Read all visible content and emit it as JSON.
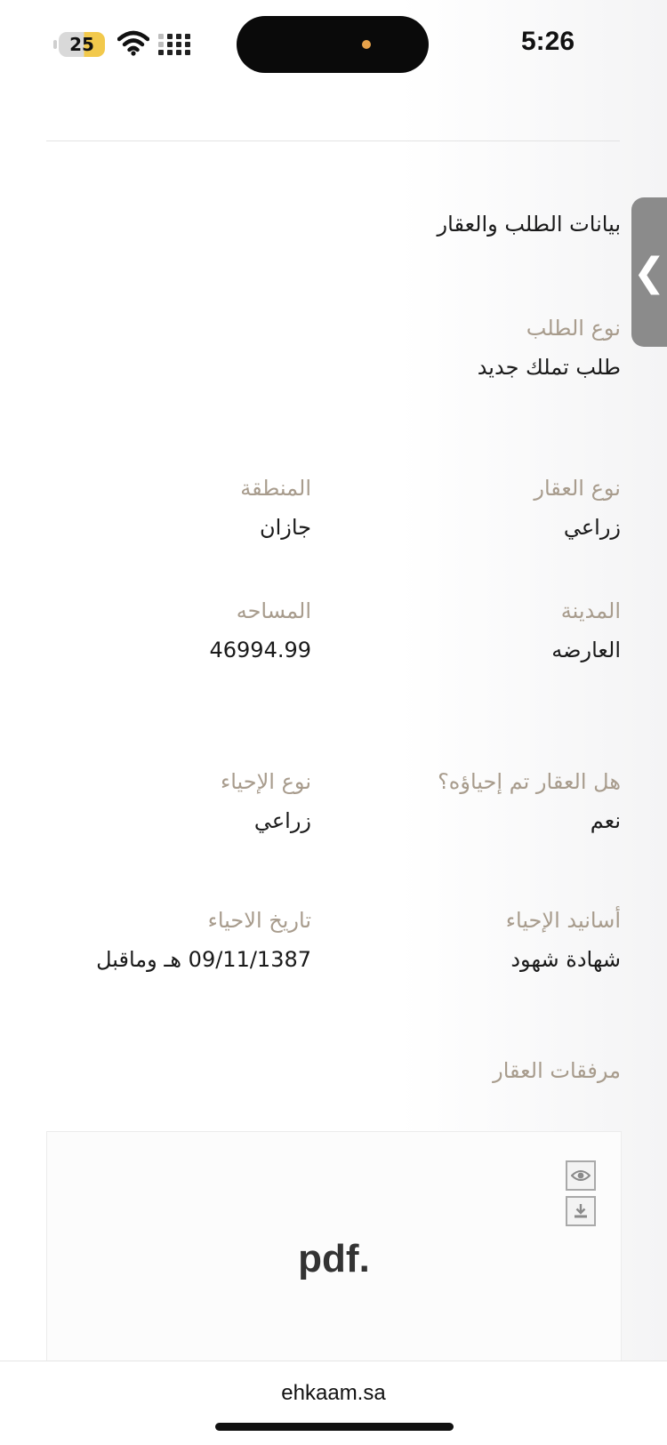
{
  "status_bar": {
    "battery_level": "25",
    "time": "5:26"
  },
  "side_tab": {
    "icon": "chevron-left-icon",
    "glyph": "❮"
  },
  "section": {
    "title": "بيانات الطلب والعقار"
  },
  "request": {
    "type_label": "نوع الطلب",
    "type_value": "طلب تملك جديد"
  },
  "property": {
    "type_label": "نوع العقار",
    "type_value": "زراعي",
    "region_label": "المنطقة",
    "region_value": "جازان",
    "city_label": "المدينة",
    "city_value": "العارضه",
    "area_label": "المساحه",
    "area_value": "46994.99",
    "revived_label": "هل العقار تم إحياؤه؟",
    "revived_value": "نعم",
    "revival_type_label": "نوع الإحياء",
    "revival_type_value": "زراعي",
    "revival_proof_label": "أسانيد الإحياء",
    "revival_proof_value": "شهادة شهود",
    "revival_date_label": "تاريخ الاحياء",
    "revival_date_value": "09/11/1387 هـ وماقبل"
  },
  "attachments": {
    "title": "مرفقات العقار",
    "file_ext": "pdf.",
    "view_icon": "eye-icon",
    "download_icon": "download-icon"
  },
  "browser": {
    "url": "ehkaam.sa"
  },
  "colors": {
    "label": "#a89c8d",
    "value": "#1a1a1a",
    "side_tab": "#8b8b8b"
  }
}
